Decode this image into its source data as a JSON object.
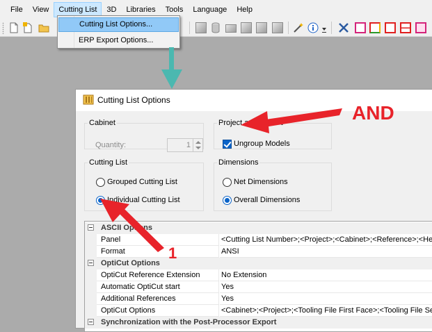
{
  "menubar": {
    "items": [
      "File",
      "View",
      "Cutting List",
      "3D",
      "Libraries",
      "Tools",
      "Language",
      "Help"
    ],
    "active_index": 2
  },
  "dropdown": {
    "items": [
      "Cutting List Options...",
      "ERP Export Options..."
    ],
    "highlighted_index": 0
  },
  "toolbar": {
    "icons": [
      "new-icon",
      "new-from-template-icon",
      "open-folder-icon",
      "cube-icon",
      "cylinder-icon",
      "box-panel-icon",
      "group-icon",
      "explode-icon",
      "copy-box-icon",
      "wand-icon",
      "info-icon",
      "dropdown-arrow-icon",
      "tools-icon",
      "frame-magenta-icon",
      "frame-color-icon",
      "frame-red-icon",
      "frame-red-split-icon",
      "frame-pink-icon"
    ],
    "colors": {
      "magenta": "#d4237a",
      "red": "#e02020",
      "yellow": "#f0b400",
      "green": "#2a9a2a",
      "blue": "#1f63c8"
    }
  },
  "dialog": {
    "title": "Cutting List Options",
    "cabinet": {
      "legend": "Cabinet",
      "quantity_label": "Quantity:",
      "quantity_value": "1"
    },
    "project": {
      "legend_visible": "Project an",
      "legend_tail": "t",
      "ungroup_label": "Ungroup Models",
      "ungroup_checked": true
    },
    "cutting_list": {
      "legend": "Cutting List",
      "options": [
        "Grouped Cutting List",
        "Individual Cutting List"
      ],
      "selected_index": 1
    },
    "dimensions": {
      "legend": "Dimensions",
      "options": [
        "Net Dimensions",
        "Overall Dimensions"
      ],
      "selected_index": 1
    },
    "grid": {
      "categories": [
        {
          "label": "ASCII Options",
          "props": [
            {
              "name": "Panel",
              "value": "<Cutting List Number>;<Project>;<Cabinet>;<Reference>;<Hei"
            },
            {
              "name": "Format",
              "value": "ANSI"
            }
          ]
        },
        {
          "label": "OptiCut Options",
          "props": [
            {
              "name": "OptiCut Reference Extension",
              "value": "No Extension"
            },
            {
              "name": "Automatic OptiCut start",
              "value": "Yes"
            },
            {
              "name": "Additional References",
              "value": "Yes"
            },
            {
              "name": "OptiCut Options",
              "value": "<Cabinet>;<Project>;<Tooling File First Face>;<Tooling File Seco"
            }
          ]
        },
        {
          "label": "Synchronization with the Post-Processor Export",
          "props": []
        }
      ]
    }
  },
  "annotations": {
    "and_label": "AND",
    "one_label": "1",
    "arrow_color": "#e8232a",
    "teal_arrow_color": "#4bb8b0"
  }
}
